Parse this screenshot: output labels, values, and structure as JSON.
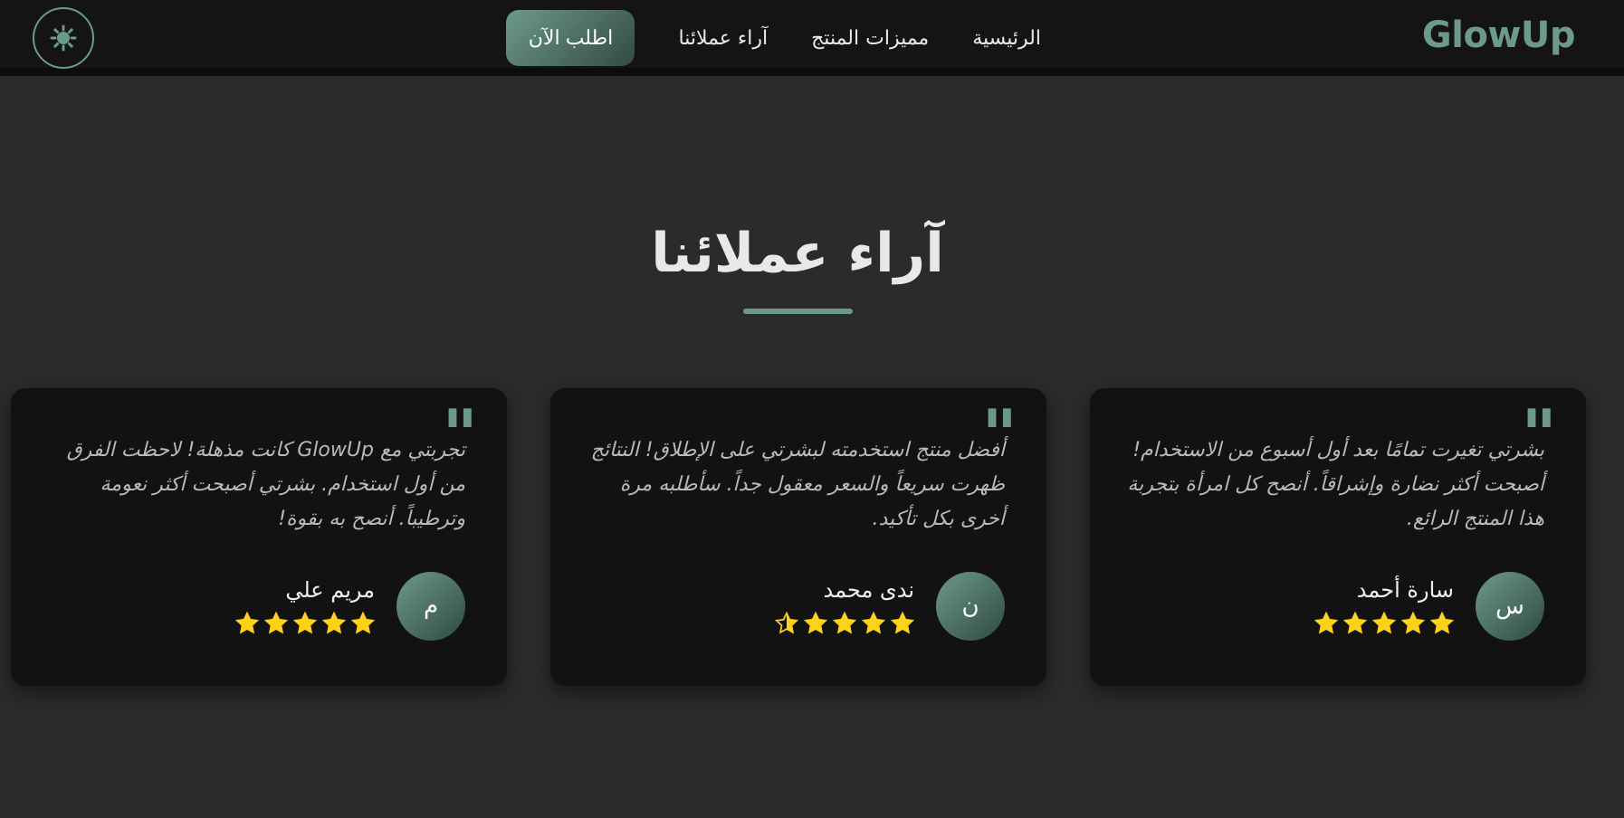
{
  "nav": {
    "brand": "GlowUp",
    "links": [
      "الرئيسية",
      "مميزات المنتج",
      "آراء عملائنا"
    ],
    "order_label": "اطلب الآن",
    "theme_icon": "sun-icon"
  },
  "section": {
    "title": "آراء عملائنا"
  },
  "colors": {
    "accent": "#6c9a88",
    "background": "#2b2b2b",
    "card": "#121212",
    "star": "#ffd21a"
  },
  "testimonials": [
    {
      "quote_mark": "\"",
      "text": "بشرتي تغيرت تمامًا بعد أول أسبوع من الاستخدام! أصبحت أكثر نضارة وإشراقاً. أنصح كل امرأة بتجربة هذا المنتج الرائع.",
      "initial": "س",
      "name": "سارة أحمد",
      "rating": 5
    },
    {
      "quote_mark": "\"",
      "text": "أفضل منتج استخدمته لبشرتي على الإطلاق! النتائج ظهرت سريعاً والسعر معقول جداً. سأطلبه مرة أخرى بكل تأكيد.",
      "initial": "ن",
      "name": "ندى محمد",
      "rating": 4.5
    },
    {
      "quote_mark": "\"",
      "text": "تجربتي مع GlowUp كانت مذهلة! لاحظت الفرق من أول استخدام. بشرتي أصبحت أكثر نعومة وترطيباً. أنصح به بقوة!",
      "initial": "م",
      "name": "مريم علي",
      "rating": 5
    }
  ]
}
